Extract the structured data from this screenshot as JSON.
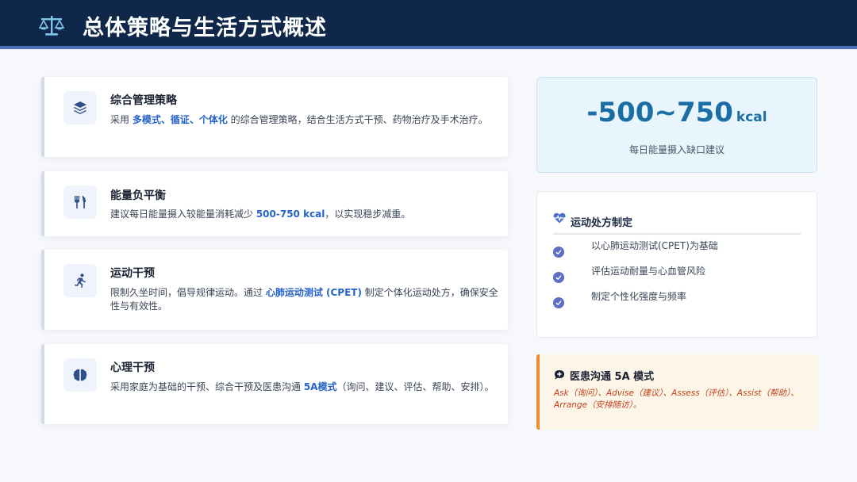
{
  "header": {
    "title": "总体策略与生活方式概述",
    "icon": "balance-scale-icon"
  },
  "cards": [
    {
      "icon": "layers-icon",
      "title": "综合管理策略",
      "desc_pre": "采用 ",
      "desc_hl": "多模式、循证、个体化",
      "desc_post": " 的综合管理策略，结合生活方式干预、药物治疗及手术治疗。"
    },
    {
      "icon": "utensils-icon",
      "title": "能量负平衡",
      "desc_pre": "建议每日能量摄入较能量消耗减少 ",
      "desc_hl": "500-750 kcal",
      "desc_post": "，以实现稳步减重。"
    },
    {
      "icon": "running-icon",
      "title": "运动干预",
      "desc_pre": "限制久坐时间，倡导规律运动。通过 ",
      "desc_hl": "心肺运动测试 (CPET)",
      "desc_post": " 制定个体化运动处方，确保安全性与有效性。"
    },
    {
      "icon": "brain-icon",
      "title": "心理干预",
      "desc_pre": "采用家庭为基础的干预、综合干预及医患沟通 ",
      "desc_hl": "5A模式",
      "desc_post": "（询问、建议、评估、帮助、安排）。"
    }
  ],
  "kpi": {
    "value": "-500~750",
    "unit": "kcal",
    "label": "每日能量摄入缺口建议"
  },
  "prescription": {
    "icon": "heartbeat-icon",
    "title": "运动处方制定",
    "items": [
      "以心肺运动测试(CPET)为基础",
      "评估运动耐量与心血管风险",
      "制定个性化强度与频率"
    ]
  },
  "communication": {
    "icon": "comment-medical-icon",
    "title": "医患沟通 5A 模式",
    "text": "Ask（询问）、Advise（建议）、Assess（评估）、Assist（帮助）、Arrange（安排随访）。"
  },
  "colors": {
    "header_bg": "#0f2748",
    "accent_blue": "#2563c9",
    "kpi_text": "#1a6ea5",
    "check": "#5a6fc7",
    "orange_accent": "#f08a2c",
    "orange_text": "#c2411c"
  }
}
